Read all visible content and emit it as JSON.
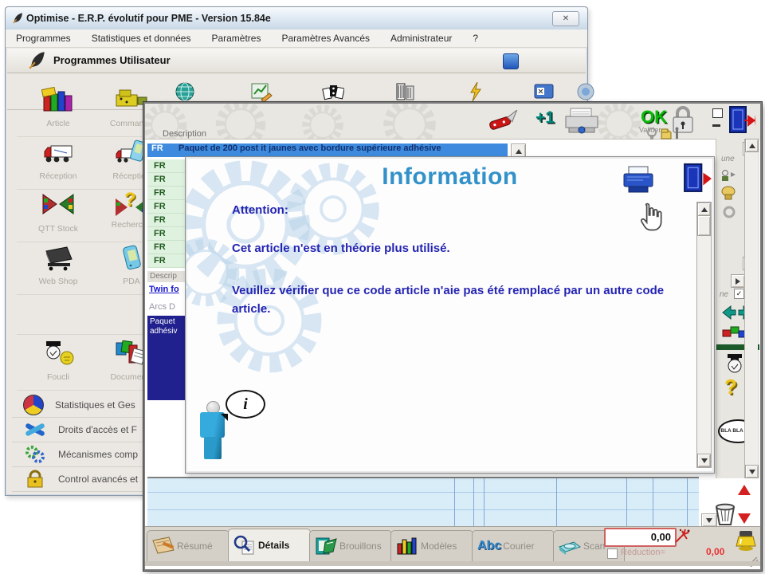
{
  "window": {
    "title": "Optimise  -  E.R.P. évolutif pour PME   -  Version 15.84e",
    "menu_items": [
      "Programmes",
      "Statistiques et données",
      "Paramètres",
      "Paramètres Avancés",
      "Administrateur",
      "?"
    ],
    "header_title": "Programmes Utilisateur",
    "programs": [
      {
        "label": "Article"
      },
      {
        "label": "Commande"
      },
      {
        "label": "Réception"
      },
      {
        "label": "Réception"
      },
      {
        "label": "QTT Stock"
      },
      {
        "label": "Recherche"
      },
      {
        "label": "Web Shop"
      },
      {
        "label": "PDA"
      },
      {
        "label": "Foucli"
      },
      {
        "label": "Documents"
      }
    ],
    "groups": [
      "Statistiques et Ges",
      "Droits d'accès et F",
      "Mécanismes comp",
      "Control avancés et"
    ]
  },
  "detail": {
    "description_label": "Description",
    "selected_lang": "FR",
    "selected_description": "Paquet de 200 post it jaunes avec bordure supérieure adhésive",
    "lang_rows": [
      "FR",
      "FR",
      "FR",
      "FR",
      "FR",
      "FR",
      "FR",
      "FR"
    ],
    "description_label2": "Descrip",
    "link_item": "Twin fo",
    "gray_item": "Arcs D",
    "selected_item_line1": "Paquet",
    "selected_item_line2": "adhésiv",
    "toolbar": {
      "plus_one": "+1",
      "ok": "OK",
      "valider": "Valider"
    },
    "right_panel": {
      "fragment_top": "une",
      "fragment_mid": "ne",
      "bubble_text": "BLA BLA BLA",
      "question_glyph": "?"
    },
    "tabs": [
      {
        "label": "Résumé"
      },
      {
        "label": "Détails",
        "active": true
      },
      {
        "label": "Brouillons"
      },
      {
        "label": "Modèles"
      },
      {
        "label": "Courier",
        "icon_text": "Abc"
      },
      {
        "label": "Scan"
      }
    ],
    "totals": {
      "amount": "0,00",
      "reduction_label": "Réduction=",
      "reduction_value": "0,00"
    }
  },
  "dialog": {
    "title": "Information",
    "attention": "Attention:",
    "line1": "Cet article n'est en théorie plus utilisé.",
    "line2": "Veuillez vérifier que ce code article n'aie pas été remplacé par un autre code article.",
    "info_glyph": "i"
  },
  "icons": {
    "close": "✕",
    "check": "✓"
  },
  "colors": {
    "accent_blue": "#3391c9",
    "selection_blue": "#3d8ade",
    "navy_selection": "#20208e",
    "text_blue": "#2424b2",
    "alert_red": "#e03030",
    "ok_green": "#00aa00"
  }
}
